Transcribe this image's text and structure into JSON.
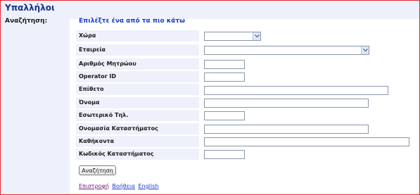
{
  "page": {
    "title": "Υπαλλήλοι"
  },
  "search": {
    "label": "Αναζήτηση:",
    "instruction": "Επιλέξτε ένα από τα πιο κάτω",
    "button_label": "Αναζήτηση"
  },
  "fields": [
    {
      "label": "Χώρα",
      "type": "select",
      "value": ""
    },
    {
      "label": "Εταιρεία",
      "type": "select",
      "value": ""
    },
    {
      "label": "Αριθμός Μητρώου",
      "type": "text",
      "value": ""
    },
    {
      "label": "Operator ID",
      "type": "text",
      "value": ""
    },
    {
      "label": "Επίθετο",
      "type": "text",
      "value": ""
    },
    {
      "label": "Όνομα",
      "type": "text",
      "value": ""
    },
    {
      "label": "Εσωτερικό Τηλ.",
      "type": "text",
      "value": ""
    },
    {
      "label": "Ονομασία Καταστήματος",
      "type": "text",
      "value": ""
    },
    {
      "label": "Καθήκοντα",
      "type": "text",
      "value": ""
    },
    {
      "label": "Κωδικός Καταστήματος",
      "type": "text",
      "value": ""
    }
  ],
  "footer": {
    "back": "Επιστροφή",
    "help": "Βοήθεια",
    "english": "English"
  },
  "icons": {
    "dropdown": "chevron-down-icon"
  },
  "colors": {
    "title": "#17318c",
    "border": "#e8252c",
    "label_bg": "#eef1fb",
    "link": "#1b3bc8",
    "visited_link": "#7a1a7a"
  }
}
